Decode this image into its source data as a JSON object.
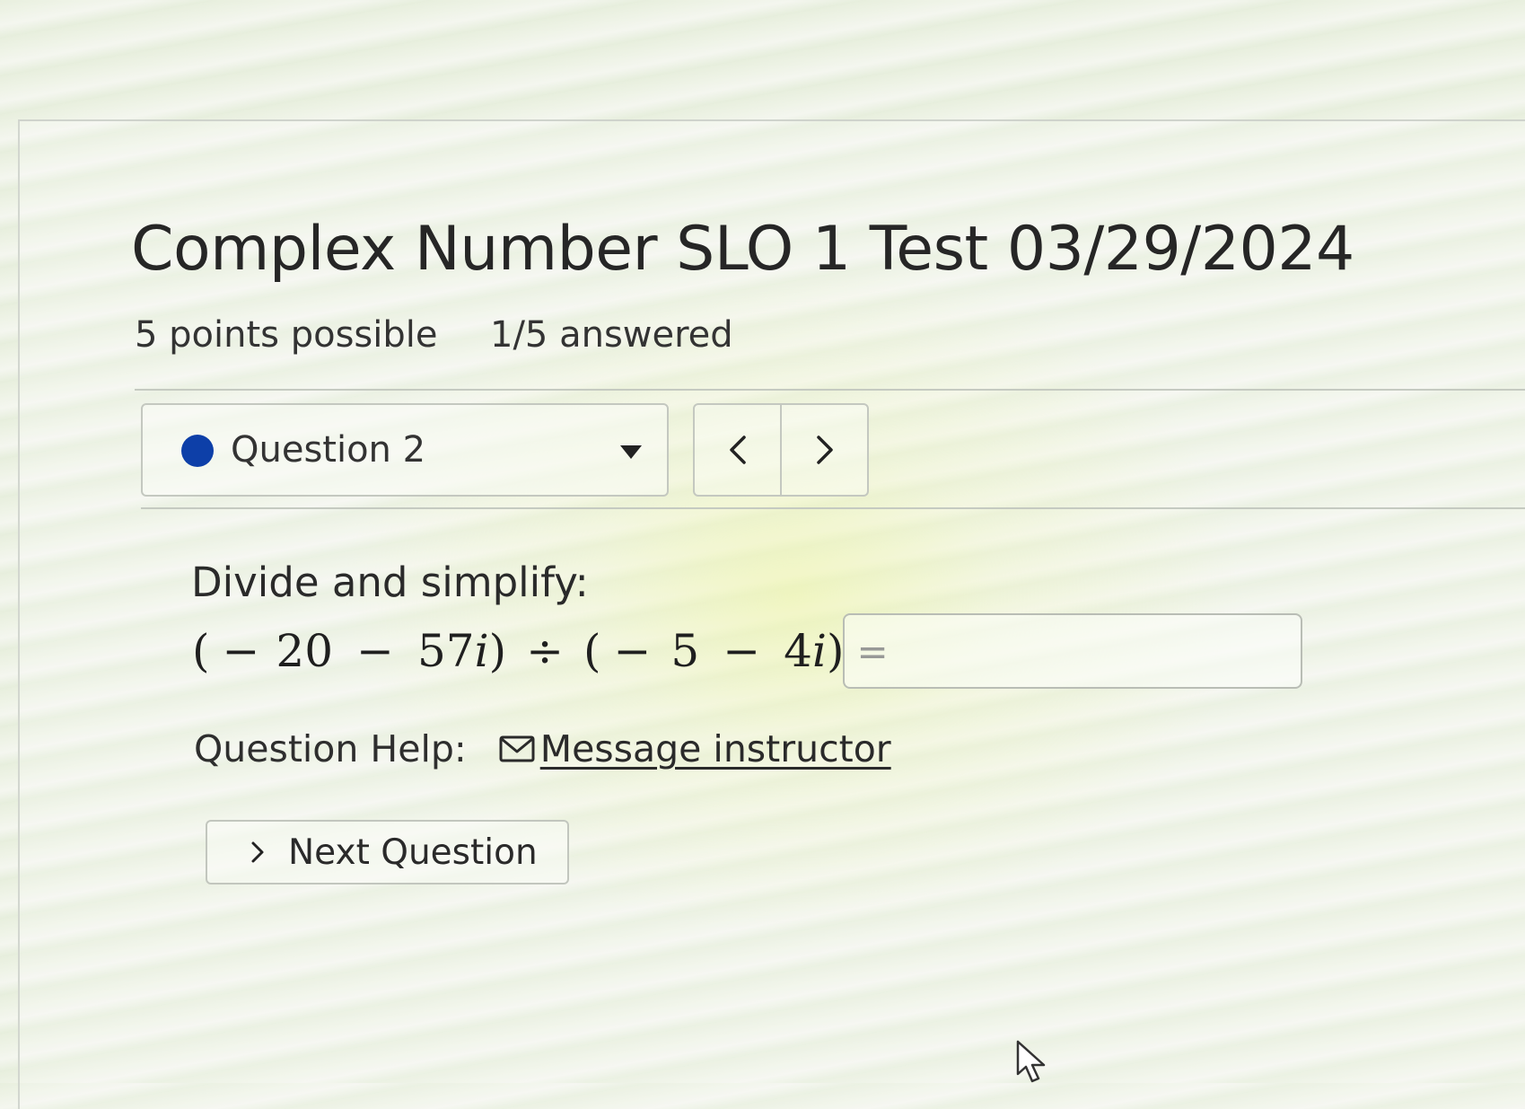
{
  "assessment": {
    "title": "Complex Number SLO 1 Test 03/29/2024",
    "points_possible": "5 points possible",
    "answered": "1/5 answered"
  },
  "question_selector": {
    "label": "Question 2",
    "status_color": "#0d3fa8",
    "icon": "chevron-down-icon"
  },
  "question_nav": {
    "prev_icon": "chevron-left-icon",
    "next_icon": "chevron-right-icon"
  },
  "question": {
    "prompt": "Divide and simplify:",
    "expression": {
      "open1": "(",
      "neg1": "−",
      "num1": "20",
      "minus1": "−",
      "num2": "57",
      "i1": "i",
      "close1": ")",
      "divide": "÷",
      "open2": "(",
      "neg2": "−",
      "num3": "5",
      "minus2": "−",
      "num4": "4",
      "i2": "i",
      "close2": ")",
      "equals": "="
    },
    "answer_value": ""
  },
  "help": {
    "label": "Question Help:",
    "link_label": "Message instructor",
    "icon": "mail-icon"
  },
  "footer": {
    "next_label": "Next Question",
    "icon": "chevron-right-icon"
  }
}
